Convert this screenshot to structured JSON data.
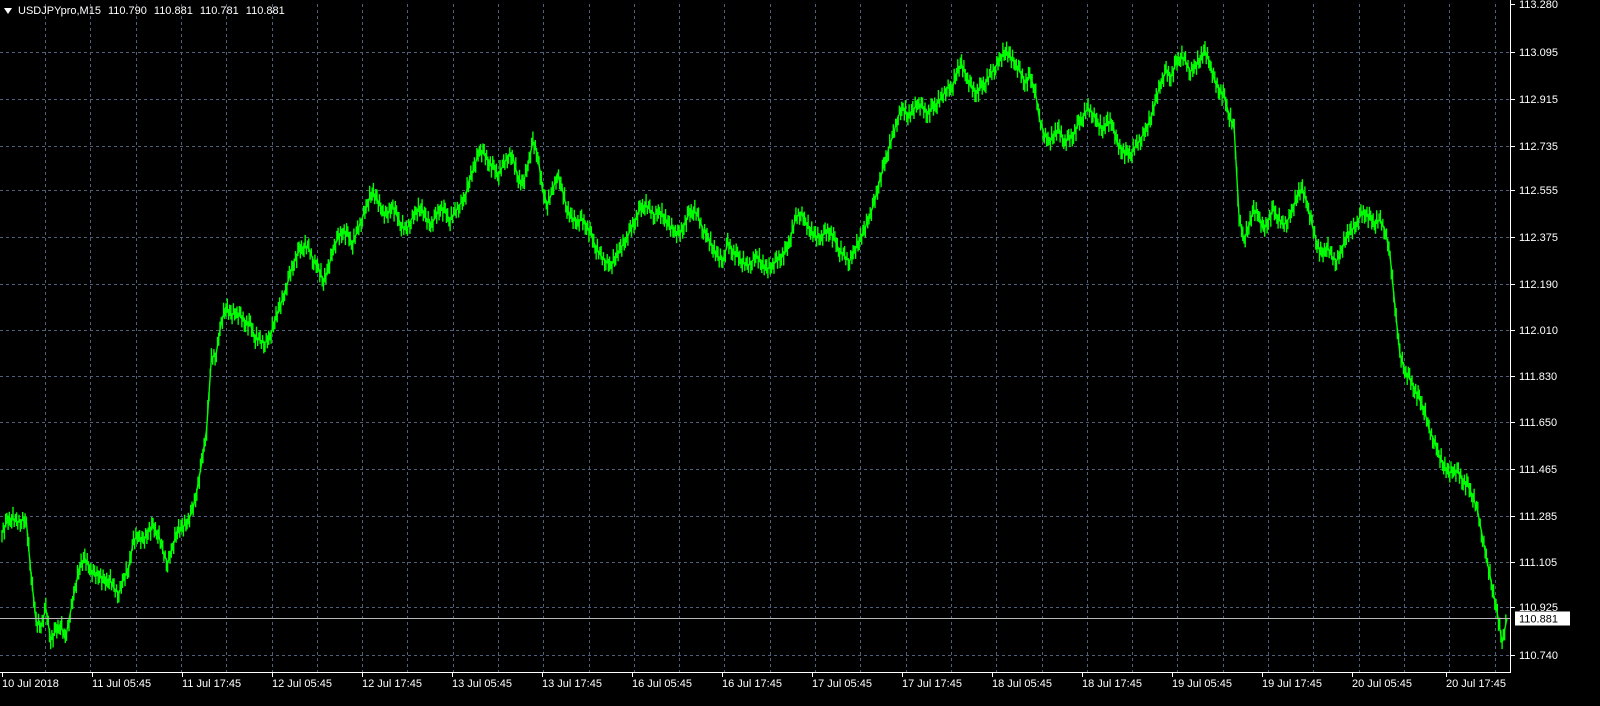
{
  "header": {
    "symbol": "USDJPYpro,M15",
    "open": "110.790",
    "high": "110.881",
    "low": "110.781",
    "close": "110.881"
  },
  "colors": {
    "background": "#000000",
    "grid": "#50607a",
    "axis": "#ffffff",
    "candle": "#00ff00",
    "price_line": "#b8b8b8",
    "price_marker_bg": "#ffffff",
    "price_marker_text": "#000000"
  },
  "icons": {
    "menu": "chevron-down-icon"
  },
  "chart_data": {
    "type": "line",
    "symbol": "USDJPYpro",
    "timeframe": "M15",
    "y_range": [
      110.65,
      113.28
    ],
    "y_ticks": [
      "113.280",
      "113.095",
      "112.915",
      "112.735",
      "112.555",
      "112.375",
      "112.190",
      "112.010",
      "111.830",
      "111.650",
      "111.465",
      "111.285",
      "111.105",
      "110.925",
      "110.740"
    ],
    "x_labels": [
      "10 Jul 2018",
      "11 Jul 05:45",
      "11 Jul 17:45",
      "12 Jul 05:45",
      "12 Jul 17:45",
      "13 Jul 05:45",
      "13 Jul 17:45",
      "16 Jul 05:45",
      "16 Jul 17:45",
      "17 Jul 05:45",
      "17 Jul 17:45",
      "18 Jul 05:45",
      "18 Jul 17:45",
      "19 Jul 05:45",
      "19 Jul 17:45",
      "20 Jul 05:45",
      "20 Jul 17:45"
    ],
    "current_price": "110.881",
    "series": [
      {
        "values": [
          111.22,
          111.26,
          111.28,
          111.26,
          111.27,
          111.26,
          111.05,
          110.87,
          110.85,
          110.92,
          110.8,
          110.83,
          110.86,
          110.8,
          110.9,
          111.0,
          111.09,
          111.12,
          111.08,
          111.05,
          111.06,
          111.02,
          111.04,
          111.0,
          110.98,
          111.04,
          111.08,
          111.19,
          111.21,
          111.18,
          111.23,
          111.24,
          111.22,
          111.15,
          111.1,
          111.16,
          111.23,
          111.24,
          111.26,
          111.3,
          111.38,
          111.49,
          111.62,
          111.9,
          111.92,
          112.04,
          112.1,
          112.07,
          112.08,
          112.06,
          112.04,
          112.03,
          111.98,
          111.97,
          111.96,
          111.98,
          112.05,
          112.1,
          112.15,
          112.22,
          112.28,
          112.32,
          112.34,
          112.33,
          112.28,
          112.25,
          112.2,
          112.25,
          112.33,
          112.37,
          112.4,
          112.38,
          112.35,
          112.4,
          112.45,
          112.5,
          112.55,
          112.52,
          112.48,
          112.45,
          112.5,
          112.46,
          112.42,
          112.4,
          112.44,
          112.47,
          112.49,
          112.45,
          112.42,
          112.45,
          112.49,
          112.47,
          112.44,
          112.47,
          112.5,
          112.52,
          112.6,
          112.65,
          112.72,
          112.7,
          112.67,
          112.64,
          112.62,
          112.66,
          112.7,
          112.68,
          112.6,
          112.58,
          112.66,
          112.75,
          112.7,
          112.55,
          112.5,
          112.55,
          112.62,
          112.56,
          112.48,
          112.45,
          112.43,
          112.44,
          112.42,
          112.38,
          112.33,
          112.3,
          112.28,
          112.26,
          112.3,
          112.33,
          112.36,
          112.4,
          112.44,
          112.48,
          112.5,
          112.48,
          112.46,
          112.47,
          112.45,
          112.42,
          112.4,
          112.38,
          112.42,
          112.46,
          112.48,
          112.45,
          112.4,
          112.37,
          112.33,
          112.3,
          112.28,
          112.35,
          112.32,
          112.3,
          112.28,
          112.26,
          112.28,
          112.3,
          112.27,
          112.25,
          112.26,
          112.28,
          112.3,
          112.32,
          112.38,
          112.45,
          112.47,
          112.43,
          112.4,
          112.38,
          112.37,
          112.39,
          112.4,
          112.36,
          112.32,
          112.3,
          112.28,
          112.32,
          112.36,
          112.4,
          112.45,
          112.5,
          112.58,
          112.65,
          112.72,
          112.78,
          112.85,
          112.88,
          112.85,
          112.87,
          112.9,
          112.88,
          112.86,
          112.88,
          112.9,
          112.92,
          112.96,
          112.95,
          113.02,
          113.05,
          113.0,
          112.96,
          112.94,
          112.96,
          112.98,
          113.01,
          113.04,
          113.07,
          113.1,
          113.08,
          113.05,
          113.02,
          112.98,
          113.0,
          112.96,
          112.84,
          112.78,
          112.75,
          112.78,
          112.8,
          112.75,
          112.76,
          112.78,
          112.82,
          112.85,
          112.88,
          112.86,
          112.82,
          112.8,
          112.83,
          112.82,
          112.74,
          112.72,
          112.7,
          112.71,
          112.74,
          112.77,
          112.8,
          112.85,
          112.92,
          112.98,
          113.02,
          113.0,
          113.05,
          113.08,
          113.06,
          113.02,
          113.04,
          113.07,
          113.1,
          113.05,
          112.98,
          112.95,
          112.92,
          112.85,
          112.8,
          112.45,
          112.36,
          112.42,
          112.48,
          112.46,
          112.4,
          112.44,
          112.48,
          112.45,
          112.42,
          112.44,
          112.48,
          112.54,
          112.56,
          112.5,
          112.42,
          112.35,
          112.3,
          112.34,
          112.3,
          112.28,
          112.32,
          112.38,
          112.4,
          112.42,
          112.46,
          112.47,
          112.44,
          112.43,
          112.44,
          112.4,
          112.3,
          112.1,
          111.92,
          111.85,
          111.82,
          111.78,
          111.74,
          111.7,
          111.62,
          111.58,
          111.52,
          111.48,
          111.45,
          111.46,
          111.45,
          111.42,
          111.4,
          111.36,
          111.3,
          111.2,
          111.1,
          111.0,
          110.9,
          110.79,
          110.881
        ]
      }
    ]
  }
}
